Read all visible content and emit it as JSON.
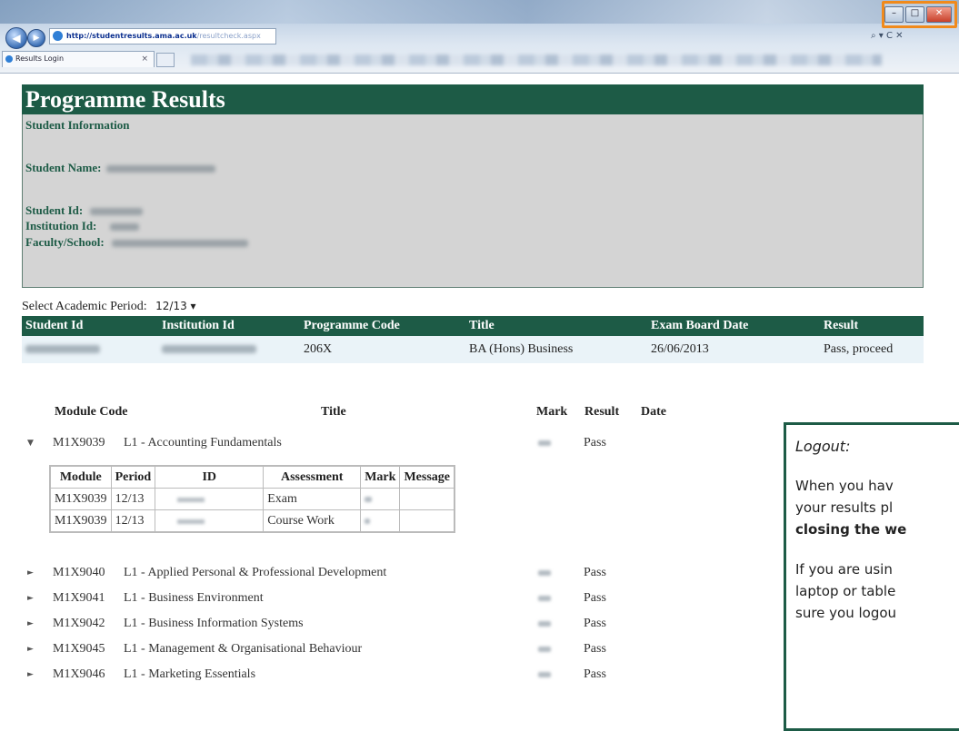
{
  "browser": {
    "url_host": "http://studentresults.ama.ac.uk",
    "url_path": "/resultcheck.aspx",
    "tab_title": "Results Login",
    "tab_close": "×",
    "search_glyph": "⌕ ▾ C ✕",
    "minimize": "–",
    "maximize": "□",
    "close": "✕"
  },
  "page": {
    "title": "Programme Results",
    "student_info_heading": "Student Information",
    "labels": {
      "student_name": "Student Name:",
      "student_id": "Student Id:",
      "institution_id": "Institution Id:",
      "faculty": "Faculty/School:"
    },
    "period_label": "Select Academic Period:",
    "period_value": "12/13"
  },
  "programme_table": {
    "headers": [
      "Student Id",
      "Institution Id",
      "Programme Code",
      "Title",
      "Exam Board Date",
      "Result"
    ],
    "row": {
      "programme_code": "206X",
      "title": "BA (Hons) Business",
      "exam_board_date": "26/06/2013",
      "result": "Pass, proceed"
    }
  },
  "modules": {
    "headers": {
      "code": "Module Code",
      "title": "Title",
      "mark": "Mark",
      "result": "Result",
      "date": "Date"
    },
    "expanded_arrow": "▼",
    "collapsed_arrow": "►",
    "rows": [
      {
        "code": "M1X9039",
        "title": "L1 - Accounting Fundamentals",
        "result": "Pass"
      },
      {
        "code": "M1X9040",
        "title": "L1 - Applied Personal & Professional Development",
        "result": "Pass"
      },
      {
        "code": "M1X9041",
        "title": "L1 - Business Environment",
        "result": "Pass"
      },
      {
        "code": "M1X9042",
        "title": "L1 - Business Information Systems",
        "result": "Pass"
      },
      {
        "code": "M1X9045",
        "title": "L1 - Management & Organisational Behaviour",
        "result": "Pass"
      },
      {
        "code": "M1X9046",
        "title": "L1 - Marketing Essentials",
        "result": "Pass"
      }
    ],
    "assessment_table": {
      "headers": [
        "Module",
        "Period",
        "ID",
        "Assessment",
        "Mark",
        "Message"
      ],
      "rows": [
        {
          "module": "M1X9039",
          "period": "12/13",
          "assessment": "Exam"
        },
        {
          "module": "M1X9039",
          "period": "12/13",
          "assessment": "Course Work"
        }
      ]
    }
  },
  "callout": {
    "heading": "Logout:",
    "line1": "When you hav",
    "line2": "your results pl",
    "line3": "closing the we",
    "line4": "If you are usin",
    "line5": "laptop or table",
    "line6": "sure you logou"
  },
  "colors": {
    "header_green": "#1d5b46",
    "info_grey": "#d4d4d4",
    "highlight_orange": "#f08a1c"
  }
}
